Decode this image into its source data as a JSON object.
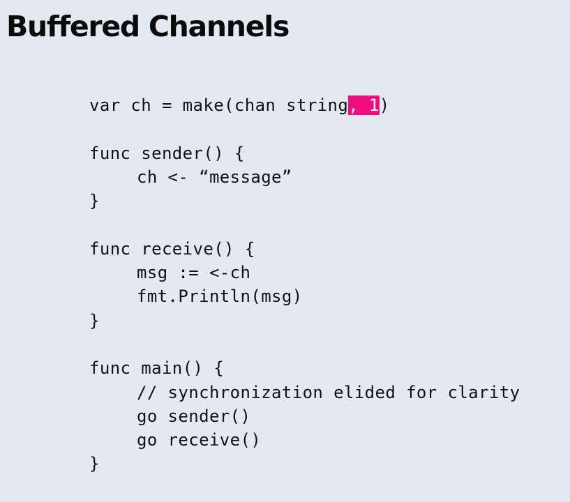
{
  "slide": {
    "title": "Buffered Channels"
  },
  "code": {
    "line_1_before": "var ch = make(chan string",
    "line_1_highlight": ", 1",
    "line_1_after": ")",
    "sender_signature": "func sender() {",
    "sender_body": "ch <- “message”",
    "sender_close": "}",
    "receive_signature": "func receive() {",
    "receive_body_1": "msg := <-ch",
    "receive_body_2": "fmt.Println(msg)",
    "receive_close": "}",
    "main_signature": "func main() {",
    "main_comment": "// synchronization elided for clarity",
    "main_body_1": "go sender()",
    "main_body_2": "go receive()",
    "main_close": "}"
  },
  "colors": {
    "background": "#e4e8f0",
    "highlight": "#f00d7e",
    "text": "#111111"
  }
}
